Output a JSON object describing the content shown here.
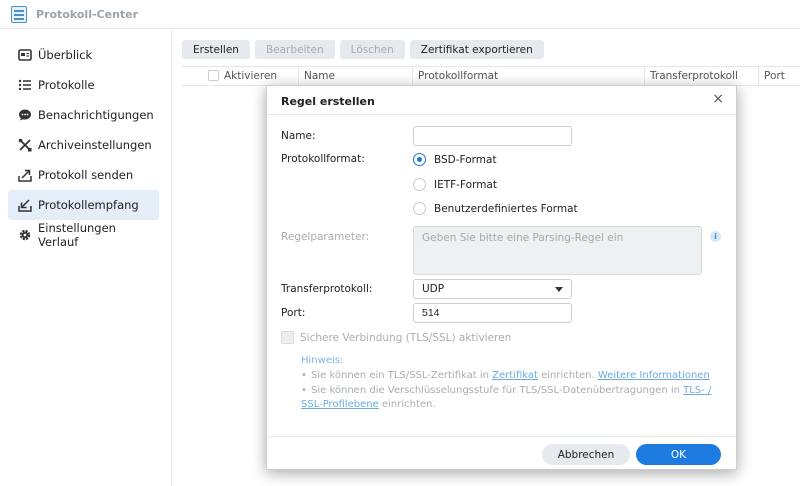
{
  "app": {
    "title": "Protokoll-Center"
  },
  "sidebar": {
    "items": [
      {
        "label": "Überblick",
        "icon": "overview-icon",
        "active": false
      },
      {
        "label": "Protokolle",
        "icon": "list-icon",
        "active": false
      },
      {
        "label": "Benachrichtigungen",
        "icon": "chat-bubble-icon",
        "active": false
      },
      {
        "label": "Archiveinstellungen",
        "icon": "tools-icon",
        "active": false
      },
      {
        "label": "Protokoll senden",
        "icon": "send-icon",
        "active": false
      },
      {
        "label": "Protokollempfang",
        "icon": "receive-icon",
        "active": true
      },
      {
        "label": "Einstellungen Verlauf",
        "icon": "gear-icon",
        "active": false
      }
    ]
  },
  "toolbar": {
    "create": "Erstellen",
    "edit": "Bearbeiten",
    "delete": "Löschen",
    "export_cert": "Zertifikat exportieren"
  },
  "table": {
    "columns": [
      "Aktivieren",
      "Name",
      "Protokollformat",
      "Transferprotokoll",
      "Port"
    ]
  },
  "dialog": {
    "title": "Regel erstellen",
    "close": "×",
    "name_label": "Name:",
    "name_value": "",
    "format_label": "Protokollformat:",
    "format_options": [
      "BSD-Format",
      "IETF-Format",
      "Benutzerdefiniertes Format"
    ],
    "format_selected": "BSD-Format",
    "rule_param_label": "Regelparameter:",
    "rule_param_placeholder": "Geben Sie bitte eine Parsing-Regel ein",
    "transfer_label": "Transferprotokoll:",
    "transfer_value": "UDP",
    "port_label": "Port:",
    "port_value": "514",
    "tls_label": "Sichere Verbindung (TLS/SSL) aktivieren",
    "hint_title": "Hinweis:",
    "hint1_pre": "Sie können ein TLS/SSL-Zertifikat in ",
    "hint1_link1": "Zertifikat",
    "hint1_mid": " einrichten. ",
    "hint1_link2": "Weitere Informationen",
    "hint2_pre": "Sie können die Verschlüsselungsstufe für TLS/SSL-Datenübertragungen in ",
    "hint2_link": "TLS- / SSL-Profilebene",
    "hint2_post": " einrichten.",
    "cancel": "Abbrechen",
    "ok": "OK"
  },
  "colors": {
    "accent": "#1e7be0",
    "active_nav": "#e3eef9"
  }
}
